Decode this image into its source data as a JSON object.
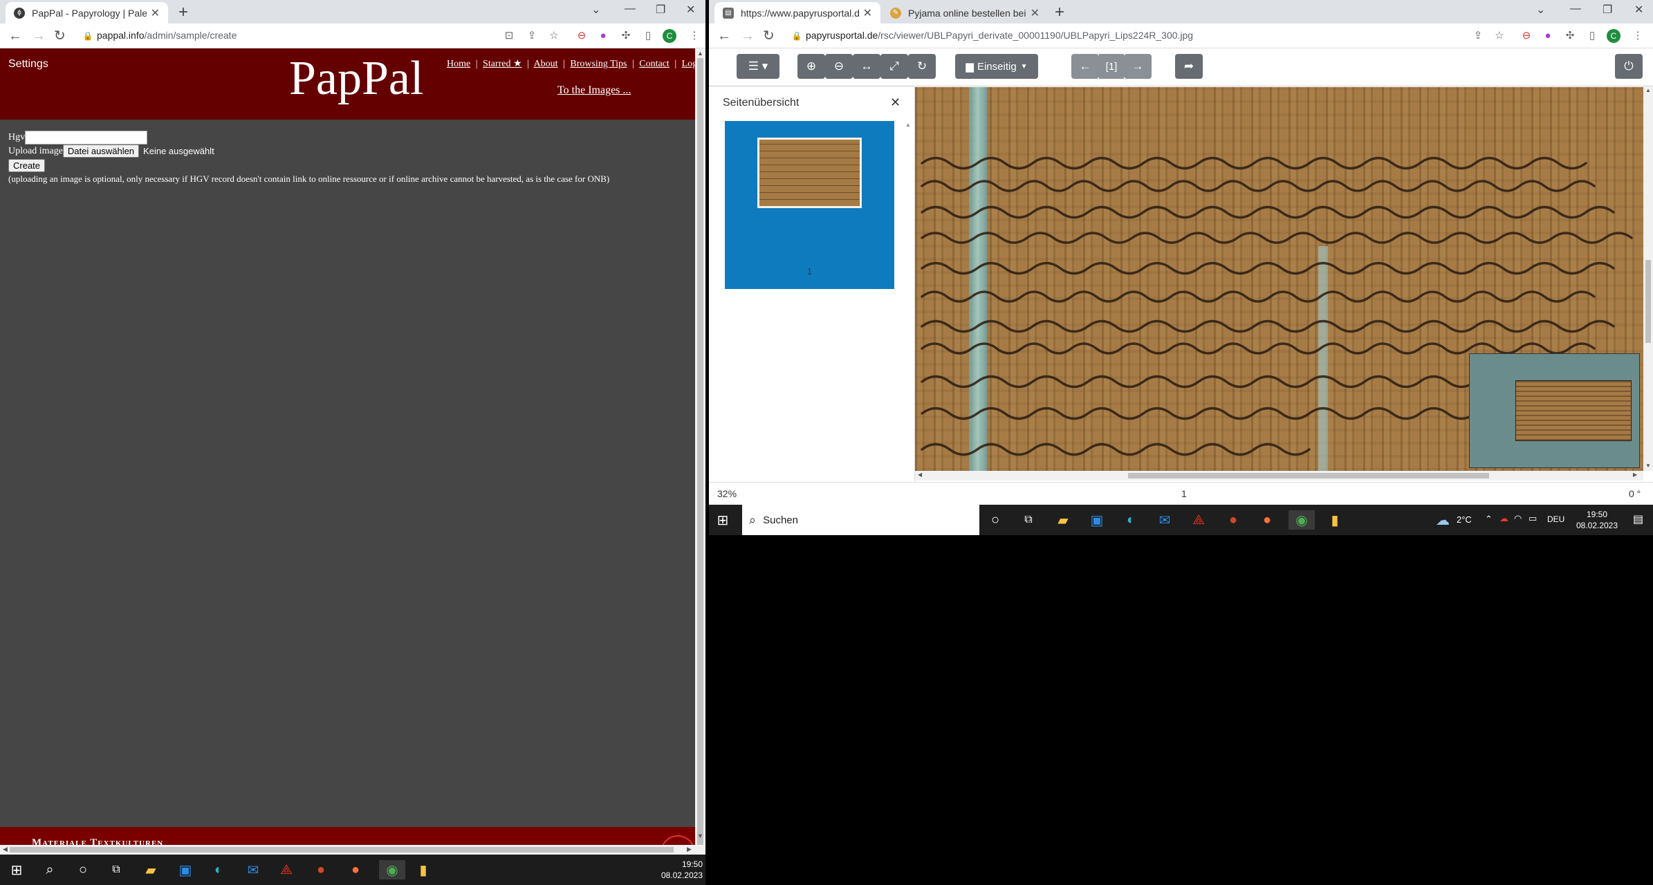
{
  "left_browser": {
    "tab_title": "PapPal - Papyrology | Paleograph",
    "url_host": "pappal.info",
    "url_path": "/admin/sample/create",
    "profile_letter": "C"
  },
  "right_browser": {
    "tabs": [
      {
        "title": "https://www.papyrusportal.de/rsc"
      },
      {
        "title": "Pyjama online bestellen bei Tchibo"
      }
    ],
    "url_host": "papyrusportal.de",
    "url_path": "/rsc/viewer/UBLPapyri_derivate_00001190/UBLPapyri_Lips224R_300.jpg",
    "profile_letter": "C"
  },
  "pappal": {
    "settings": "Settings",
    "logo": "PapPal",
    "nav": [
      "Home",
      "Starred ★",
      "About",
      "Browsing Tips",
      "Contact",
      "Logout"
    ],
    "separator": "|",
    "to_images": "To the Images ...",
    "form": {
      "hgv_label": "Hgv",
      "hgv_value": "",
      "upload_label": "Upload image",
      "file_button": "Datei auswählen",
      "file_status": "Keine ausgewählt",
      "create_button": "Create",
      "note": "(uploading an image is optional, only necessary if HGV record doesn't contain link to online ressource or if online archive cannot be harvested, as is the case for ONB)"
    },
    "footer_text": "Materiale Textkulturen"
  },
  "viewer": {
    "layout_select": "Einseitig",
    "page_indicator": "[1]",
    "sidebar_title": "Seitenübersicht",
    "thumb_label": "1",
    "zoom": "32%",
    "page_num": "1",
    "rotation": "0 °"
  },
  "taskbar_left": {
    "time": "19:50",
    "date": "08.02.2023"
  },
  "taskbar_right": {
    "search_placeholder": "Suchen",
    "weather": "2°C",
    "lang": "DEU",
    "time": "19:50",
    "date": "08.02.2023"
  },
  "colors": {
    "pappal_red": "#650000",
    "pappal_body": "#464646",
    "viewer_blue": "#0f7bbf",
    "papyrus": "#a57a45"
  }
}
